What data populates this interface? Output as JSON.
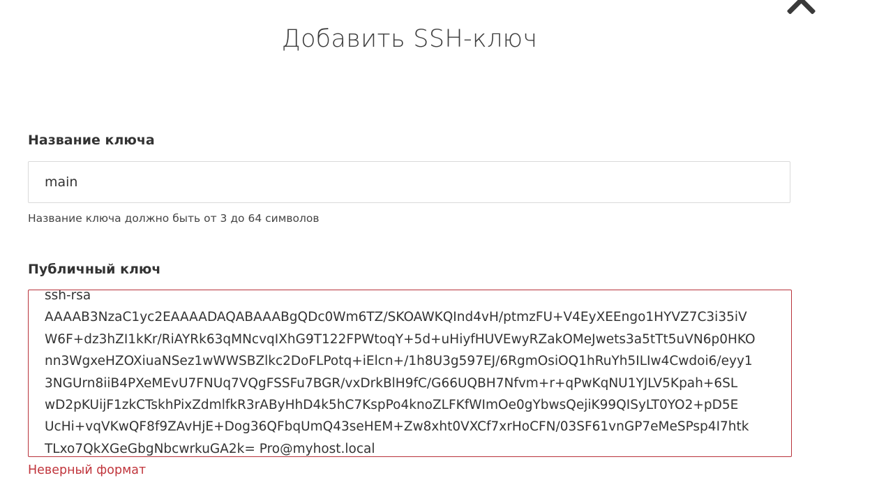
{
  "dialog": {
    "title": "Добавить SSH-ключ",
    "close_icon": "close-icon"
  },
  "key_name": {
    "label": "Название ключа",
    "value": "main",
    "hint": "Название ключа должно быть от 3 до 64 символов"
  },
  "public_key": {
    "label": "Публичный ключ",
    "lines": [
      "ssh-rsa",
      "AAAAB3NzaC1yc2EAAAADAQABAAABgQDc0Wm6TZ/SKOAWKQInd4vH/ptmzFU+V4EyXEEngo1HYVZ7C3i35iV",
      "W6F+dz3hZI1kKr/RiAYRk63qMNcvqIXhG9T122FPWtoqY+5d+uHiyfHUVEwyRZakOMeJwets3a5tTt5uVN6p0HKO",
      "nn3WgxeHZOXiuaNSez1wWWSBZlkc2DoFLPotq+iElcn+/1h8U3g597EJ/6RgmOsiOQ1hRuYh5ILIw4Cwdoi6/eyy1",
      "3NGUrn8iiB4PXeMEvU7FNUq7VQgFSSFu7BGR/vxDrkBlH9fC/G66UQBH7Nfvm+r+qPwKqNU1YJLV5Kpah+6SL",
      "wD2pKUijF1zkCTskhPixZdmlfkR3rAByHhD4k5hC7KspPo4knoZLFKfWImOe0gYbwsQejiK99QISyLT0YO2+pD5E",
      "UcHi+vqVKwQF8f9ZAvHjE+Dog36QFbqUmQ43seHEM+Zw8xht0VXCf7xrHoCFN/03SF61vnGP7eMeSPsp4I7htk",
      "TLxo7QkXGeGbgNbcwrkuGA2k= Pro@myhost.local"
    ],
    "error": "Неверный формат"
  },
  "colors": {
    "error": "#c0353c",
    "border": "#d9d9d9"
  }
}
